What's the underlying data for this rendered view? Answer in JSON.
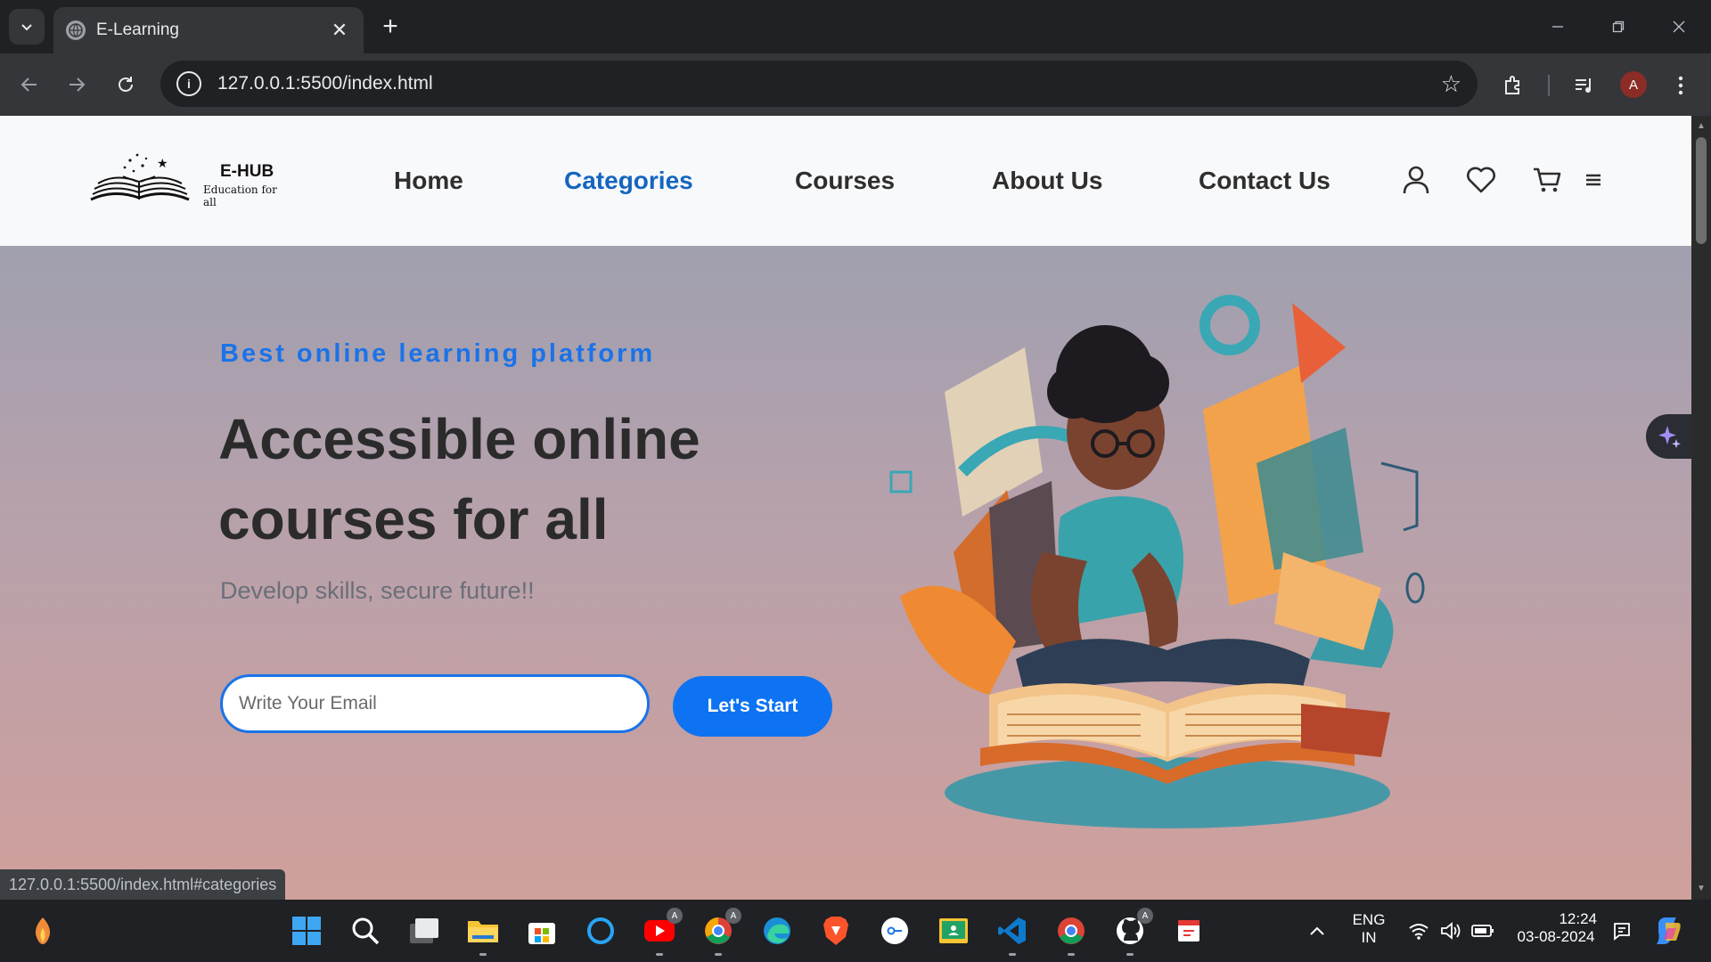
{
  "browser": {
    "tab_title": "E-Learning",
    "url": "127.0.0.1:5500/index.html",
    "profile_initial": "A",
    "status_url": "127.0.0.1:5500/index.html#categories"
  },
  "site": {
    "logo_name": "E-HUB",
    "logo_tagline": "Education for all",
    "nav": [
      "Home",
      "Categories",
      "Courses",
      "About Us",
      "Contact Us"
    ],
    "active_nav": "Categories",
    "header_icons": [
      "user-icon",
      "heart-icon",
      "cart-icon",
      "menu-icon"
    ]
  },
  "hero": {
    "eyebrow": "Best online learning platform",
    "title_line1": "Accessible online",
    "title_line2": "courses for all",
    "subtitle": "Develop skills, secure future!!",
    "email_placeholder": "Write Your Email",
    "cta_label": "Let's Start",
    "illustration": "child-reading-book-illustration"
  },
  "taskbar": {
    "lang_line1": "ENG",
    "lang_line2": "IN",
    "time": "12:24",
    "date": "03-08-2024",
    "badge_letter": "A"
  },
  "colors": {
    "accent": "#1a73e8",
    "active_nav": "#1565c0",
    "cta": "#0d73f2",
    "heading": "#2b2b2b"
  }
}
